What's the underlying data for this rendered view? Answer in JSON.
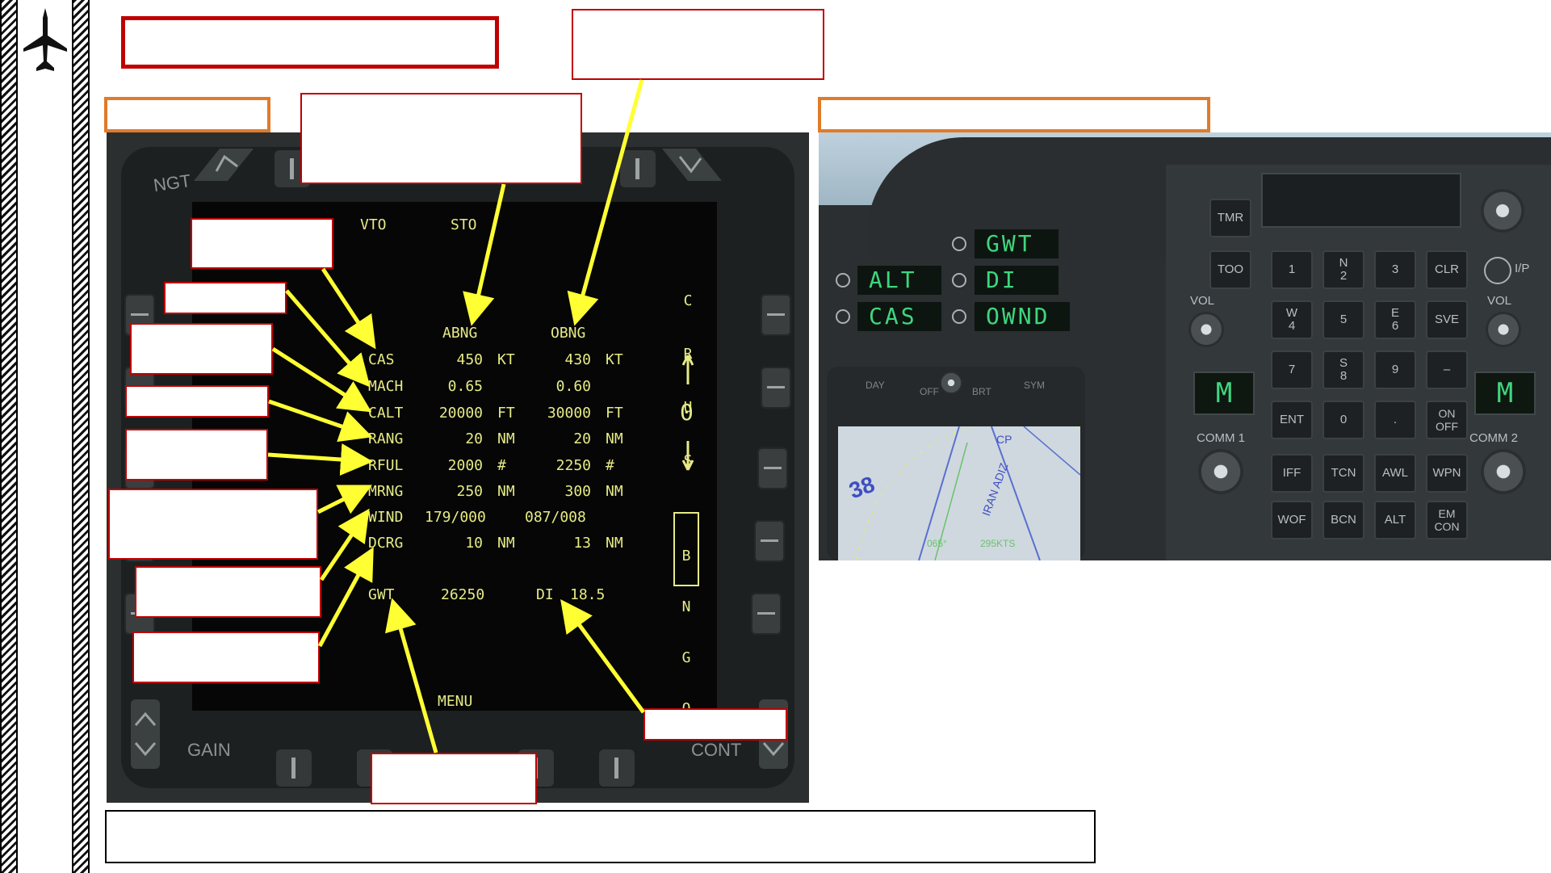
{
  "mfd": {
    "bezel_labels": {
      "ngt": "NGT",
      "gain": "GAIN",
      "cont": "CONT",
      "menu": "MENU"
    },
    "modes": {
      "vto": "VTO",
      "sto": "STO"
    },
    "columns": {
      "abng": "ABNG",
      "obng": "OBNG"
    },
    "rows": [
      {
        "label": "CAS",
        "abng": "450",
        "abng_unit": "KT",
        "obng": "430",
        "obng_unit": "KT"
      },
      {
        "label": "MACH",
        "abng": "0.65",
        "abng_unit": "",
        "obng": "0.60",
        "obng_unit": ""
      },
      {
        "label": "CALT",
        "abng": "20000",
        "abng_unit": "FT",
        "obng": "30000",
        "obng_unit": "FT"
      },
      {
        "label": "RANG",
        "abng": "20",
        "abng_unit": "NM",
        "obng": "20",
        "obng_unit": "NM"
      },
      {
        "label": "RFUL",
        "abng": "2000",
        "abng_unit": "#",
        "obng": "2250",
        "obng_unit": "#"
      },
      {
        "label": "MRNG",
        "abng": "250",
        "abng_unit": "NM",
        "obng": "300",
        "obng_unit": "NM"
      },
      {
        "label": "WIND",
        "abng": "179/000",
        "abng_unit": "",
        "obng": "087/008",
        "obng_unit": ""
      },
      {
        "label": "DCRG",
        "abng": "10",
        "abng_unit": "NM",
        "obng": "13",
        "obng_unit": "NM"
      }
    ],
    "gwt": {
      "label": "GWT",
      "value": "26250"
    },
    "di": {
      "label": "DI",
      "value": "18.5"
    },
    "crus": [
      "C",
      "R",
      "U",
      "S"
    ],
    "bngo": [
      "B",
      "N",
      "G",
      "O"
    ],
    "zero": "0"
  },
  "ufc": {
    "options": {
      "gwt": "GWT",
      "alt": "ALT",
      "di": "DI",
      "cas": "CAS",
      "ownd": "OWND"
    },
    "labels": {
      "tmr": "TMR",
      "too": "TOO",
      "vol_left": "VOL",
      "vol_right": "VOL",
      "ip": "I/P",
      "comm1": "COMM 1",
      "comm2": "COMM 2",
      "day": "DAY",
      "off": "OFF",
      "brt": "BRT",
      "sym": "SYM"
    },
    "comm_display": "M",
    "keypad": [
      {
        "main": "1",
        "sub": ""
      },
      {
        "main": "2",
        "sub": "N"
      },
      {
        "main": "3",
        "sub": ""
      },
      {
        "main": "4",
        "sub": "W"
      },
      {
        "main": "5",
        "sub": ""
      },
      {
        "main": "6",
        "sub": "E"
      },
      {
        "main": "7",
        "sub": ""
      },
      {
        "main": "8",
        "sub": "S"
      },
      {
        "main": "9",
        "sub": ""
      },
      {
        "main": "ENT",
        "sub": ""
      },
      {
        "main": "0",
        "sub": ""
      },
      {
        "main": ".",
        "sub": ""
      }
    ],
    "side_keys": {
      "clr": "CLR",
      "sve": "SVE",
      "dash": "–",
      "onoff": "ON\nOFF"
    },
    "bottom_keys": [
      "IFF",
      "TCN",
      "AWL",
      "WPN",
      "WOF",
      "BCN",
      "ALT",
      "EM\nCON"
    ],
    "map": {
      "heading": "065°",
      "speed": "295KTS",
      "label": "IRAN ADIZ",
      "marker": "CP",
      "number": "38"
    }
  },
  "colors": {
    "callout_red": "#c00000",
    "callout_orange": "#e07b2a",
    "arrow": "#ffff33",
    "mfd_text": "#e7ea86",
    "ufc_text": "#3fd67e"
  }
}
